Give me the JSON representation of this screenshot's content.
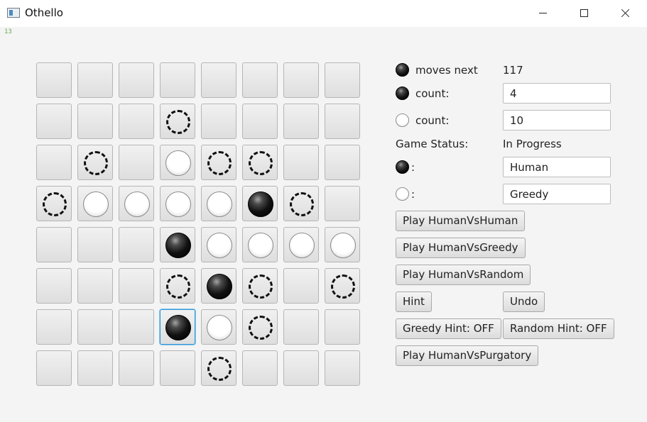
{
  "window": {
    "title": "Othello",
    "icon": "app-window-icon"
  },
  "corner_tag": "13",
  "board": {
    "rows": [
      "........",
      "...H....",
      ".H.WHH..",
      "HWWWWBH.",
      "...BWWWW",
      "...HBH.H",
      "...BWH..",
      "....H..."
    ],
    "selected": [
      6,
      3
    ]
  },
  "panel": {
    "moves_next_label": "moves next",
    "moves_next_value": "117",
    "black_count_label": "count:",
    "black_count_value": "4",
    "white_count_label": "count:",
    "white_count_value": "10",
    "status_label": "Game Status:",
    "status_value": "In Progress",
    "black_player_label": ":",
    "black_player_value": "Human",
    "white_player_label": ":",
    "white_player_value": "Greedy"
  },
  "buttons": {
    "human_vs_human": "Play HumanVsHuman",
    "human_vs_greedy": "Play HumanVsGreedy",
    "human_vs_random": "Play HumanVsRandom",
    "hint": "Hint",
    "undo": "Undo",
    "greedy_hint": "Greedy Hint: OFF",
    "random_hint": "Random Hint: OFF",
    "human_vs_purgatory": "Play HumanVsPurgatory"
  }
}
